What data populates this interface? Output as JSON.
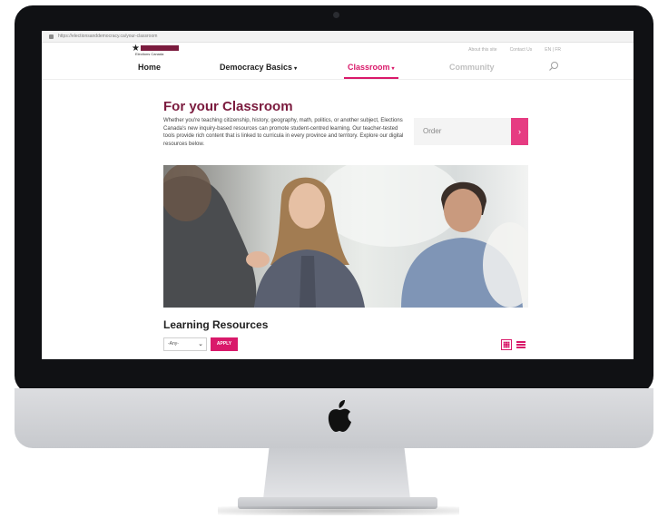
{
  "browser": {
    "url": "https://electionsanddemocracy.ca/your-classroom"
  },
  "brand": {
    "name": "Elections Canada"
  },
  "utility_nav": [
    "About this site",
    "Contact Us",
    "EN | FR"
  ],
  "nav": {
    "items": [
      {
        "label": "Home",
        "caret": ""
      },
      {
        "label": "Democracy Basics",
        "caret": "▾"
      },
      {
        "label": "Classroom",
        "caret": "▾"
      },
      {
        "label": "Community",
        "caret": ""
      }
    ]
  },
  "page": {
    "title": "For your Classroom",
    "intro": "Whether you're teaching citizenship, history, geography, math, politics, or another subject, Elections Canada's new inquiry-based resources can promote student-centred learning. Our teacher-tested tools provide rich content that is linked to curricula in every province and territory. Explore our digital resources below."
  },
  "order": {
    "label": "Order",
    "arrow": "›"
  },
  "resources": {
    "title": "Learning Resources",
    "filter_value": "-Any-",
    "filter_caret": "⌄",
    "apply_label": "APPLY"
  },
  "colors": {
    "accent": "#d9196a",
    "title": "#7b1b3e",
    "order_button": "#e63c82"
  }
}
